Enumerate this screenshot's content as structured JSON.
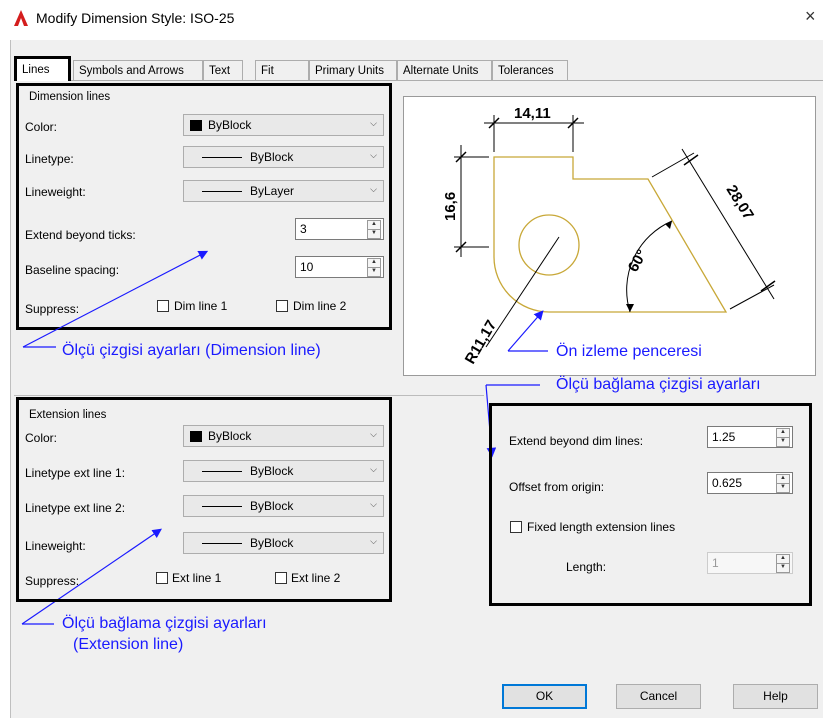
{
  "window": {
    "title": "Modify Dimension Style: ISO-25",
    "close_glyph": "×",
    "logo_icon": "autocad-logo-icon"
  },
  "tabs": [
    {
      "label": "Lines",
      "active": true
    },
    {
      "label": "Symbols and Arrows"
    },
    {
      "label": "Text"
    },
    {
      "label": "Fit"
    },
    {
      "label": "Primary Units"
    },
    {
      "label": "Alternate Units"
    },
    {
      "label": "Tolerances"
    }
  ],
  "dimension_lines": {
    "title": "Dimension lines",
    "color_label": "Color:",
    "color_value": "ByBlock",
    "linetype_label": "Linetype:",
    "linetype_value": "ByBlock",
    "lineweight_label": "Lineweight:",
    "lineweight_value": "ByLayer",
    "extend_label": "Extend beyond ticks:",
    "extend_value": "3",
    "baseline_label": "Baseline spacing:",
    "baseline_value": "10",
    "suppress_label": "Suppress:",
    "dim_line1": "Dim line 1",
    "dim_line2": "Dim line 2"
  },
  "extension_lines": {
    "title": "Extension lines",
    "color_label": "Color:",
    "color_value": "ByBlock",
    "linetype1_label": "Linetype ext line 1:",
    "linetype1_value": "ByBlock",
    "linetype2_label": "Linetype ext line 2:",
    "linetype2_value": "ByBlock",
    "lineweight_label": "Lineweight:",
    "lineweight_value": "ByBlock",
    "suppress_label": "Suppress:",
    "ext_line1": "Ext line 1",
    "ext_line2": "Ext line 2"
  },
  "ext_settings": {
    "extend_label": "Extend beyond dim lines:",
    "extend_value": "1.25",
    "offset_label": "Offset from origin:",
    "offset_value": "0.625",
    "fixed_label": "Fixed length extension lines",
    "length_label": "Length:",
    "length_value": "1"
  },
  "preview": {
    "dim_top": "14,11",
    "dim_left": "16,6",
    "dim_diag": "28,07",
    "dim_angle": "60°",
    "dim_radius": "R11,17"
  },
  "annotations": {
    "dimension_line": "Ölçü  çizgisi ayarları  (Dimension line)",
    "preview_window": "Ön izleme penceresi",
    "ext_settings_top": "Ölçü  bağlama çizgisi ayarları",
    "ext_line_1": "Ölçü  bağlama çizgisi ayarları",
    "ext_line_2": "(Extension line)"
  },
  "buttons": {
    "ok": "OK",
    "cancel": "Cancel",
    "help": "Help"
  },
  "colors": {
    "annotation": "#1a1aff",
    "geometry": "#c8a838",
    "dialog_bg": "#f0f0f0"
  }
}
